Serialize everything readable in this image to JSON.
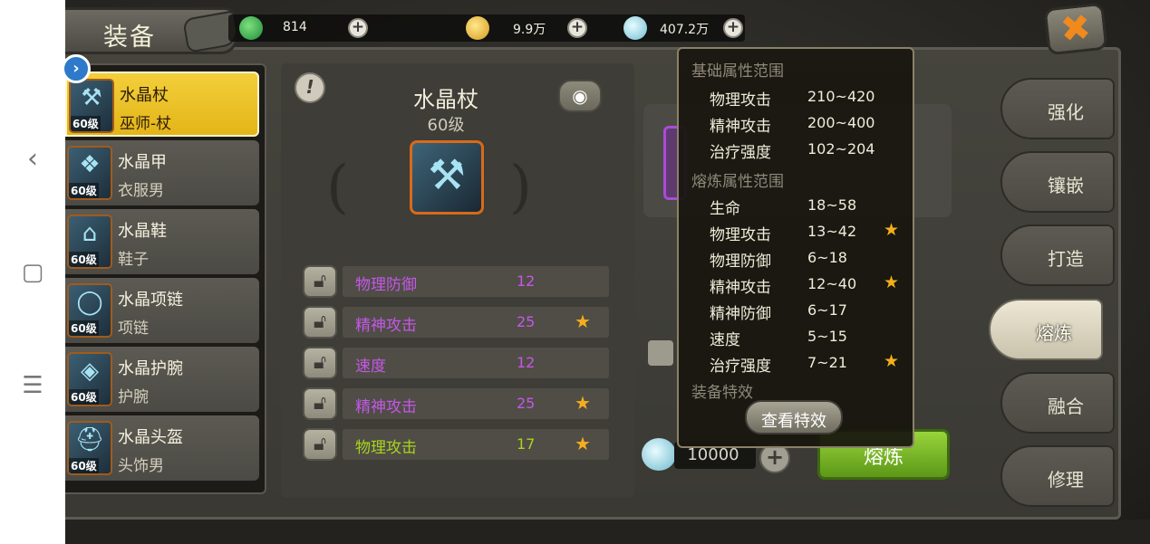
{
  "android_nav": {
    "back": "‹",
    "home": "▢",
    "menu": "☰"
  },
  "header": {
    "title": "装备",
    "close_icon": "✖"
  },
  "currencies": [
    {
      "icon": "green-gem-icon",
      "value": "814",
      "plus": "+"
    },
    {
      "icon": "gold-ingot-icon",
      "value": "9.9万",
      "plus": "+"
    },
    {
      "icon": "shell-icon",
      "value": "407.2万",
      "plus": "+"
    }
  ],
  "equipment_list": [
    {
      "name": "水晶杖",
      "sub": "巫师-杖",
      "level": "60级",
      "active": true
    },
    {
      "name": "水晶甲",
      "sub": "衣服男",
      "level": "60级",
      "active": false
    },
    {
      "name": "水晶鞋",
      "sub": "鞋子",
      "level": "60级",
      "active": false
    },
    {
      "name": "水晶项链",
      "sub": "项链",
      "level": "60级",
      "active": false
    },
    {
      "name": "水晶护腕",
      "sub": "护腕",
      "level": "60级",
      "active": false
    },
    {
      "name": "水晶头盔",
      "sub": "头饰男",
      "level": "60级",
      "active": false
    }
  ],
  "detail": {
    "title": "水晶杖",
    "level": "60级",
    "info_glyph": "!",
    "eye_glyph": "◉"
  },
  "attributes": [
    {
      "name": "物理防御",
      "value": "12",
      "star": false,
      "color": "#c657e8"
    },
    {
      "name": "精神攻击",
      "value": "25",
      "star": true,
      "color": "#c657e8"
    },
    {
      "name": "速度",
      "value": "12",
      "star": false,
      "color": "#c657e8"
    },
    {
      "name": "精神攻击",
      "value": "25",
      "star": true,
      "color": "#c657e8"
    },
    {
      "name": "物理攻击",
      "value": "17",
      "star": true,
      "color": "#a9d31f"
    }
  ],
  "cost": {
    "value": "10000",
    "plus": "+"
  },
  "smelt_button": "熔炼",
  "tooltip": {
    "base_title": "基础属性范围",
    "base_rows": [
      {
        "name": "物理攻击",
        "range": "210~420"
      },
      {
        "name": "精神攻击",
        "range": "200~400"
      },
      {
        "name": "治疗强度",
        "range": "102~204"
      }
    ],
    "smelt_title": "熔炼属性范围",
    "smelt_rows": [
      {
        "name": "生命",
        "range": "18~58",
        "star": false
      },
      {
        "name": "物理攻击",
        "range": "13~42",
        "star": true
      },
      {
        "name": "物理防御",
        "range": "6~18",
        "star": false
      },
      {
        "name": "精神攻击",
        "range": "12~40",
        "star": true
      },
      {
        "name": "精神防御",
        "range": "6~17",
        "star": false
      },
      {
        "name": "速度",
        "range": "5~15",
        "star": false
      },
      {
        "name": "治疗强度",
        "range": "7~21",
        "star": true
      }
    ],
    "effect_title": "装备特效",
    "effect_button": "查看特效"
  },
  "side_tabs": [
    {
      "label": "强化",
      "active": false
    },
    {
      "label": "镶嵌",
      "active": false
    },
    {
      "label": "打造",
      "active": false
    },
    {
      "label": "熔炼",
      "active": true
    },
    {
      "label": "融合",
      "active": false
    },
    {
      "label": "修理",
      "active": false
    }
  ],
  "colors": {
    "accent_gold": "#f3cf3a",
    "smelt_green": "#7cbc28",
    "close_orange": "#f08a1c",
    "purple_attr": "#c657e8",
    "green_attr": "#a9d31f"
  }
}
